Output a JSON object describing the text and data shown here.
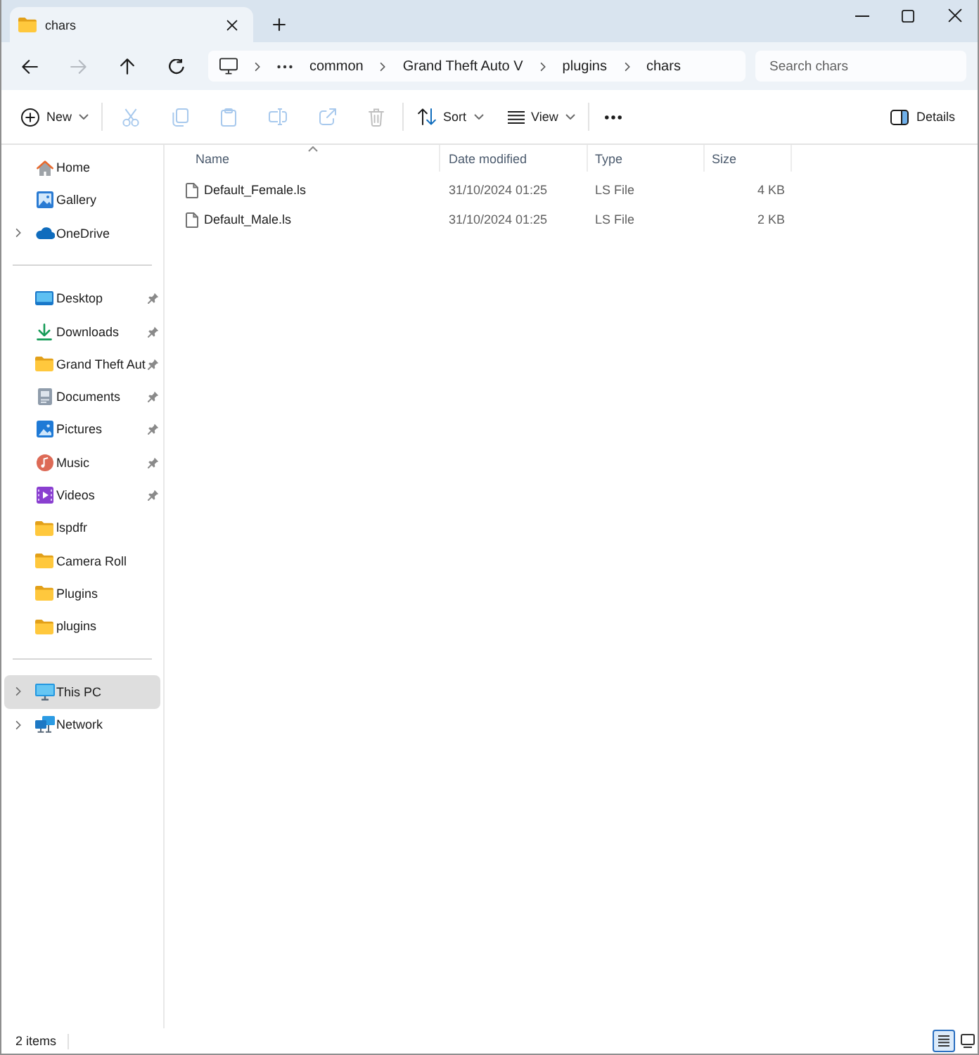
{
  "window": {
    "tabs": [
      {
        "label": "chars",
        "selected": true
      }
    ]
  },
  "navigation": {
    "buttons": [
      {
        "kind": "back",
        "disabled": false
      },
      {
        "kind": "forward",
        "disabled": true
      },
      {
        "kind": "up",
        "disabled": false
      },
      {
        "kind": "refresh",
        "disabled": false
      }
    ]
  },
  "address_bar": {
    "segments": [
      "common",
      "Grand Theft Auto V",
      "plugins",
      "chars"
    ]
  },
  "search": {
    "placeholder": "Search chars"
  },
  "command_bar": {
    "groups": [
      [
        {
          "kind": "new",
          "label": "New",
          "disabled": false
        }
      ],
      [
        {
          "kind": "cut",
          "disabled": true
        },
        {
          "kind": "copy",
          "disabled": true
        },
        {
          "kind": "paste",
          "disabled": true
        },
        {
          "kind": "rename",
          "disabled": true
        },
        {
          "kind": "share",
          "disabled": true
        },
        {
          "kind": "delete",
          "disabled": true
        }
      ],
      [
        {
          "kind": "sort",
          "label": "Sort",
          "disabled": false
        },
        {
          "kind": "view",
          "label": "View",
          "disabled": false
        }
      ],
      [
        {
          "kind": "more",
          "disabled": false
        }
      ]
    ],
    "details_button": {
      "label": "Details"
    }
  },
  "sidebar": {
    "sections": [
      {
        "items": [
          {
            "label": "Home",
            "kind": "home",
            "expandable": false,
            "pinned": false,
            "selected": false
          },
          {
            "label": "Gallery",
            "kind": "gallery",
            "expandable": false,
            "pinned": false,
            "selected": false
          },
          {
            "label": "OneDrive",
            "kind": "onedrive",
            "expandable": true,
            "pinned": false,
            "selected": false
          }
        ]
      },
      {
        "items": [
          {
            "label": "Desktop",
            "kind": "desktop",
            "expandable": false,
            "pinned": true,
            "selected": false
          },
          {
            "label": "Downloads",
            "kind": "downloads",
            "expandable": false,
            "pinned": true,
            "selected": false
          },
          {
            "label": "Grand Theft Aut",
            "kind": "folder",
            "expandable": false,
            "pinned": true,
            "selected": false
          },
          {
            "label": "Documents",
            "kind": "documents",
            "expandable": false,
            "pinned": true,
            "selected": false
          },
          {
            "label": "Pictures",
            "kind": "pictures",
            "expandable": false,
            "pinned": true,
            "selected": false
          },
          {
            "label": "Music",
            "kind": "music",
            "expandable": false,
            "pinned": true,
            "selected": false
          },
          {
            "label": "Videos",
            "kind": "videos",
            "expandable": false,
            "pinned": true,
            "selected": false
          },
          {
            "label": "lspdfr",
            "kind": "folder",
            "expandable": false,
            "pinned": false,
            "selected": false
          },
          {
            "label": "Camera Roll",
            "kind": "folder",
            "expandable": false,
            "pinned": false,
            "selected": false
          },
          {
            "label": "Plugins",
            "kind": "folder",
            "expandable": false,
            "pinned": false,
            "selected": false
          },
          {
            "label": "plugins",
            "kind": "folder",
            "expandable": false,
            "pinned": false,
            "selected": false
          }
        ]
      },
      {
        "items": [
          {
            "label": "This PC",
            "kind": "this_pc",
            "expandable": true,
            "pinned": false,
            "selected": true
          },
          {
            "label": "Network",
            "kind": "network",
            "expandable": true,
            "pinned": false,
            "selected": false
          }
        ]
      }
    ]
  },
  "file_list": {
    "columns": [
      {
        "label": "Name",
        "sorted": true
      },
      {
        "label": "Date modified",
        "sorted": false
      },
      {
        "label": "Type",
        "sorted": false
      },
      {
        "label": "Size",
        "sorted": false
      }
    ],
    "rows": [
      {
        "name": "Default_Female.ls",
        "date_modified": "31/10/2024 01:25",
        "type": "LS File",
        "size": "4 KB"
      },
      {
        "name": "Default_Male.ls",
        "date_modified": "31/10/2024 01:25",
        "type": "LS File",
        "size": "2 KB"
      }
    ]
  },
  "status_bar": {
    "item_count": "2 items",
    "view_buttons": [
      {
        "kind": "details",
        "selected": true
      },
      {
        "kind": "tiles",
        "selected": false
      }
    ]
  }
}
